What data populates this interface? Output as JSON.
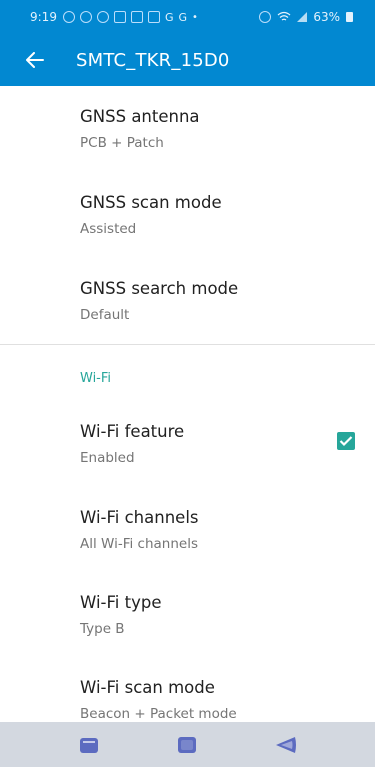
{
  "status_bar": {
    "time": "9:19",
    "battery": "63%"
  },
  "app_bar": {
    "title": "SMTC_TKR_15D0"
  },
  "settings": [
    {
      "title": "GNSS antenna",
      "subtitle": "PCB + Patch"
    },
    {
      "title": "GNSS scan mode",
      "subtitle": "Assisted"
    },
    {
      "title": "GNSS search mode",
      "subtitle": "Default"
    }
  ],
  "wifi_section": {
    "header": "Wi-Fi",
    "items": [
      {
        "title": "Wi-Fi feature",
        "subtitle": "Enabled",
        "checked": true
      },
      {
        "title": "Wi-Fi channels",
        "subtitle": "All Wi-Fi channels"
      },
      {
        "title": "Wi-Fi type",
        "subtitle": "Type B"
      },
      {
        "title": "Wi-Fi scan mode",
        "subtitle": "Beacon + Packet mode"
      }
    ]
  },
  "colors": {
    "primary": "#0288d1",
    "accent": "#26a69a",
    "nav_bar": "#d3d8e0"
  },
  "icons": {
    "back": "back-arrow-icon",
    "checkbox": "checkbox-checked-icon",
    "nav_recent": "recent-apps-icon",
    "nav_home": "home-icon",
    "nav_back": "back-icon"
  }
}
